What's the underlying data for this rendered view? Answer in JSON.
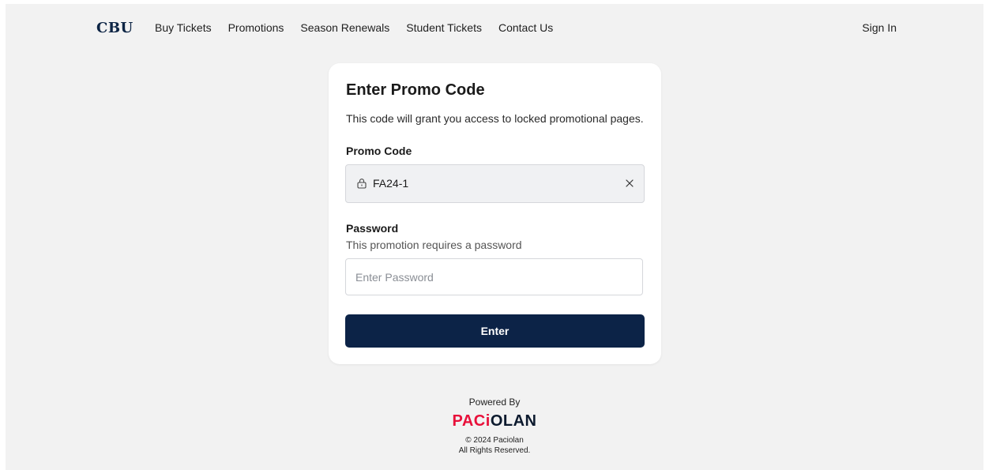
{
  "header": {
    "logo": "CBU",
    "nav": [
      {
        "label": "Buy Tickets"
      },
      {
        "label": "Promotions"
      },
      {
        "label": "Season Renewals"
      },
      {
        "label": "Student Tickets"
      },
      {
        "label": "Contact Us"
      }
    ],
    "sign_in": "Sign In"
  },
  "card": {
    "title": "Enter Promo Code",
    "subtitle": "This code will grant you access to locked promotional pages.",
    "promo_label": "Promo Code",
    "promo_value": "FA24-1",
    "password_label": "Password",
    "password_hint": "This promotion requires a password",
    "password_placeholder": "Enter Password",
    "password_value": "",
    "enter_label": "Enter"
  },
  "footer": {
    "powered_by": "Powered By",
    "brand_red": "PACi",
    "brand_dark": "OLAN",
    "copyright": "© 2024 Paciolan",
    "rights": "All Rights Reserved."
  },
  "icons": {
    "promo_icon": "lock-icon",
    "clear_icon": "close-icon"
  },
  "colors": {
    "primary": "#0c2347",
    "brand_red": "#e8103a",
    "page_background": "#f2f2f2"
  }
}
